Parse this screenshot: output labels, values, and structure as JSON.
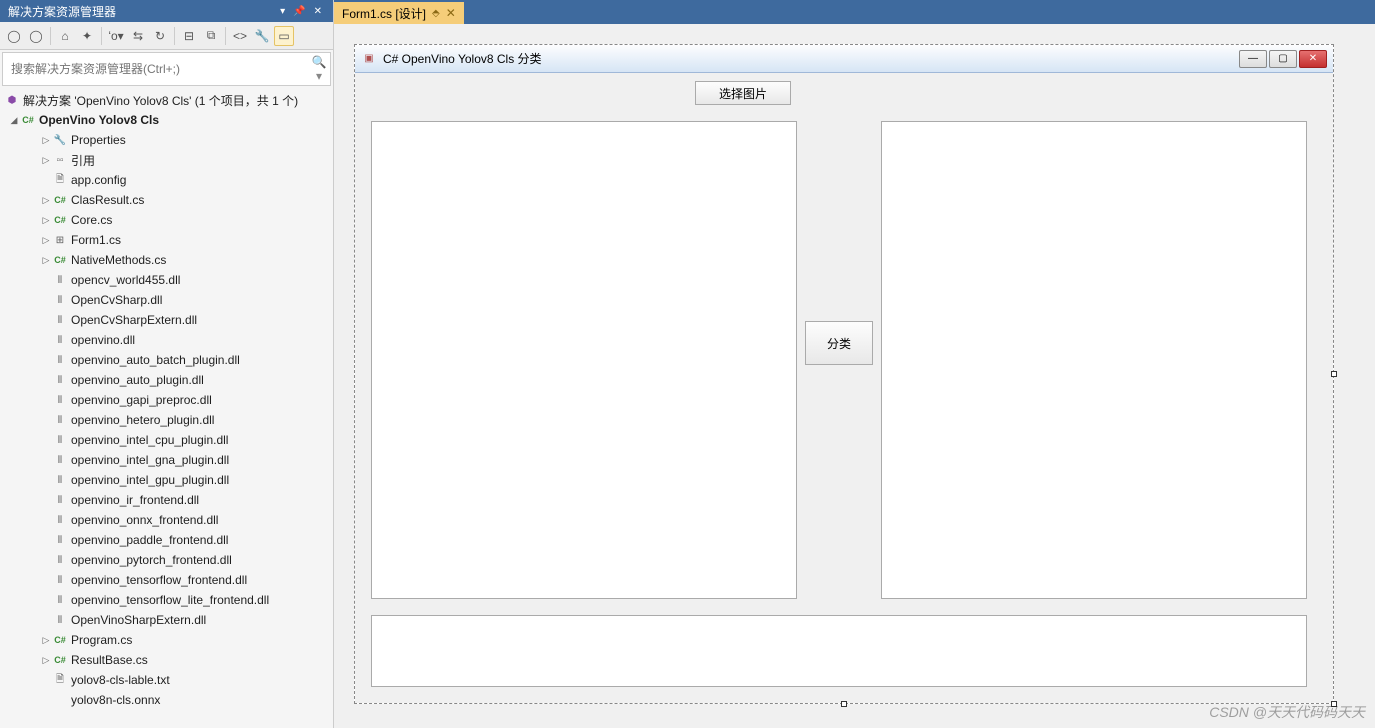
{
  "explorer": {
    "title": "解决方案资源管理器",
    "search_placeholder": "搜索解决方案资源管理器(Ctrl+;)",
    "solution_label": "解决方案 'OpenVino Yolov8 Cls' (1 个项目，共 1 个)",
    "project_label": "OpenVino Yolov8 Cls",
    "tree": [
      {
        "indent": 2,
        "arrow": "▷",
        "icon": "🔧",
        "iconClass": "ic-prop",
        "label": "Properties"
      },
      {
        "indent": 2,
        "arrow": "▷",
        "icon": "▫▫",
        "iconClass": "ic-ref",
        "label": "引用"
      },
      {
        "indent": 2,
        "arrow": "",
        "icon": "🗎",
        "iconClass": "ic-txt",
        "label": "app.config"
      },
      {
        "indent": 2,
        "arrow": "▷",
        "icon": "C#",
        "iconClass": "ic-cs",
        "label": "ClasResult.cs"
      },
      {
        "indent": 2,
        "arrow": "▷",
        "icon": "C#",
        "iconClass": "ic-cs",
        "label": "Core.cs"
      },
      {
        "indent": 2,
        "arrow": "▷",
        "icon": "⊞",
        "iconClass": "ic-form",
        "label": "Form1.cs"
      },
      {
        "indent": 2,
        "arrow": "▷",
        "icon": "C#",
        "iconClass": "ic-cs",
        "label": "NativeMethods.cs"
      },
      {
        "indent": 2,
        "arrow": "",
        "icon": "⦀",
        "iconClass": "ic-dll",
        "label": "opencv_world455.dll"
      },
      {
        "indent": 2,
        "arrow": "",
        "icon": "⦀",
        "iconClass": "ic-dll",
        "label": "OpenCvSharp.dll"
      },
      {
        "indent": 2,
        "arrow": "",
        "icon": "⦀",
        "iconClass": "ic-dll",
        "label": "OpenCvSharpExtern.dll"
      },
      {
        "indent": 2,
        "arrow": "",
        "icon": "⦀",
        "iconClass": "ic-dll",
        "label": "openvino.dll"
      },
      {
        "indent": 2,
        "arrow": "",
        "icon": "⦀",
        "iconClass": "ic-dll",
        "label": "openvino_auto_batch_plugin.dll"
      },
      {
        "indent": 2,
        "arrow": "",
        "icon": "⦀",
        "iconClass": "ic-dll",
        "label": "openvino_auto_plugin.dll"
      },
      {
        "indent": 2,
        "arrow": "",
        "icon": "⦀",
        "iconClass": "ic-dll",
        "label": "openvino_gapi_preproc.dll"
      },
      {
        "indent": 2,
        "arrow": "",
        "icon": "⦀",
        "iconClass": "ic-dll",
        "label": "openvino_hetero_plugin.dll"
      },
      {
        "indent": 2,
        "arrow": "",
        "icon": "⦀",
        "iconClass": "ic-dll",
        "label": "openvino_intel_cpu_plugin.dll"
      },
      {
        "indent": 2,
        "arrow": "",
        "icon": "⦀",
        "iconClass": "ic-dll",
        "label": "openvino_intel_gna_plugin.dll"
      },
      {
        "indent": 2,
        "arrow": "",
        "icon": "⦀",
        "iconClass": "ic-dll",
        "label": "openvino_intel_gpu_plugin.dll"
      },
      {
        "indent": 2,
        "arrow": "",
        "icon": "⦀",
        "iconClass": "ic-dll",
        "label": "openvino_ir_frontend.dll"
      },
      {
        "indent": 2,
        "arrow": "",
        "icon": "⦀",
        "iconClass": "ic-dll",
        "label": "openvino_onnx_frontend.dll"
      },
      {
        "indent": 2,
        "arrow": "",
        "icon": "⦀",
        "iconClass": "ic-dll",
        "label": "openvino_paddle_frontend.dll"
      },
      {
        "indent": 2,
        "arrow": "",
        "icon": "⦀",
        "iconClass": "ic-dll",
        "label": "openvino_pytorch_frontend.dll"
      },
      {
        "indent": 2,
        "arrow": "",
        "icon": "⦀",
        "iconClass": "ic-dll",
        "label": "openvino_tensorflow_frontend.dll"
      },
      {
        "indent": 2,
        "arrow": "",
        "icon": "⦀",
        "iconClass": "ic-dll",
        "label": "openvino_tensorflow_lite_frontend.dll"
      },
      {
        "indent": 2,
        "arrow": "",
        "icon": "⦀",
        "iconClass": "ic-dll",
        "label": "OpenVinoSharpExtern.dll"
      },
      {
        "indent": 2,
        "arrow": "▷",
        "icon": "C#",
        "iconClass": "ic-cs",
        "label": "Program.cs"
      },
      {
        "indent": 2,
        "arrow": "▷",
        "icon": "C#",
        "iconClass": "ic-cs",
        "label": "ResultBase.cs"
      },
      {
        "indent": 2,
        "arrow": "",
        "icon": "🗎",
        "iconClass": "ic-txt",
        "label": "yolov8-cls-lable.txt"
      },
      {
        "indent": 2,
        "arrow": "",
        "icon": "",
        "iconClass": "",
        "label": "yolov8n-cls.onnx"
      }
    ]
  },
  "tab": {
    "label": "Form1.cs [设计]"
  },
  "form": {
    "title": "C# OpenVino Yolov8 Cls 分类",
    "select_button": "选择图片",
    "classify_button": "分类"
  },
  "watermark": "CSDN @天天代码码天天"
}
